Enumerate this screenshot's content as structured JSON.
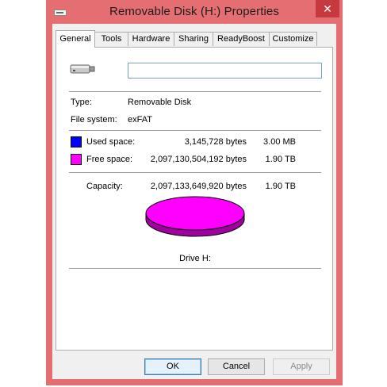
{
  "window": {
    "title": "Removable Disk (H:) Properties",
    "close_glyph": "✕"
  },
  "tabs": [
    {
      "label": "General",
      "active": true
    },
    {
      "label": "Tools"
    },
    {
      "label": "Hardware"
    },
    {
      "label": "Sharing"
    },
    {
      "label": "ReadyBoost"
    },
    {
      "label": "Customize"
    }
  ],
  "general": {
    "name_value": "",
    "type_label": "Type:",
    "type_value": "Removable Disk",
    "fs_label": "File system:",
    "fs_value": "exFAT",
    "used": {
      "label": "Used space:",
      "bytes": "3,145,728 bytes",
      "size": "3.00 MB",
      "color": "#0000ff"
    },
    "free": {
      "label": "Free space:",
      "bytes": "2,097,130,504,192 bytes",
      "size": "1.90 TB",
      "color": "#ff00ff"
    },
    "capacity": {
      "label": "Capacity:",
      "bytes": "2,097,133,649,920 bytes",
      "size": "1.90 TB"
    },
    "drive_label": "Drive H:",
    "pie": {
      "used_fraction": 1.5e-06,
      "top_color": "#ff00ff",
      "side_color": "#a000a0"
    }
  },
  "buttons": {
    "ok": "OK",
    "cancel": "Cancel",
    "apply": "Apply"
  },
  "icons": {
    "drive": "usb-drive-icon",
    "window": "drive-window-icon",
    "close": "close-icon"
  }
}
